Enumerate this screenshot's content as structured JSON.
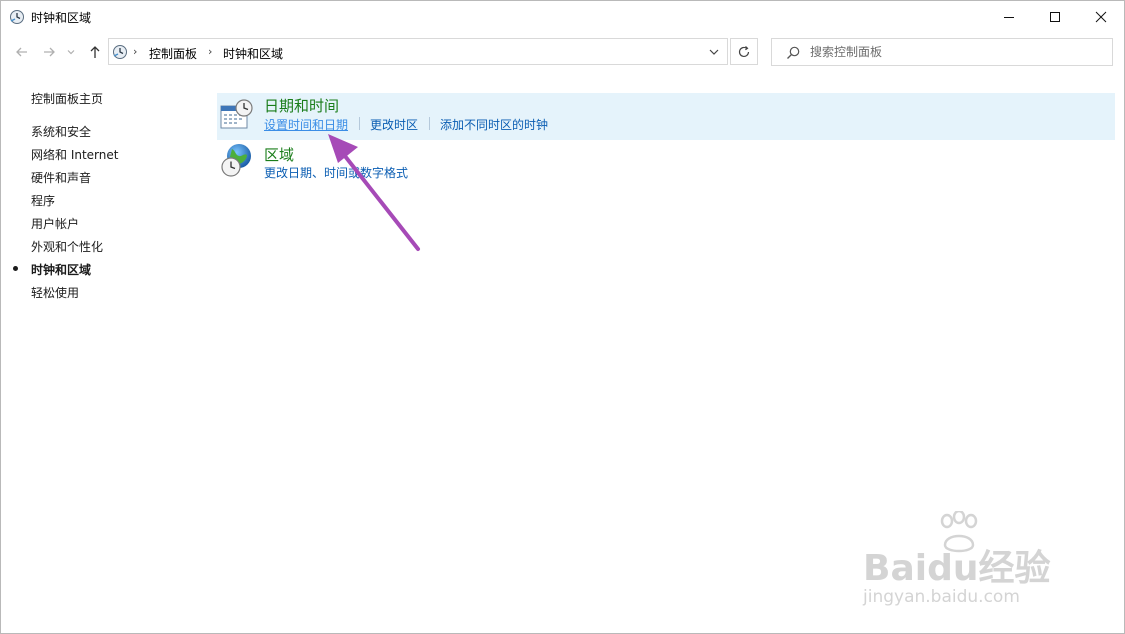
{
  "window": {
    "title": "时钟和区域",
    "controls": {
      "minimize": "minimize",
      "maximize": "maximize",
      "close": "close"
    }
  },
  "address": {
    "breadcrumb": [
      "控制面板",
      "时钟和区域"
    ]
  },
  "search": {
    "placeholder": "搜索控制面板"
  },
  "sidebar": {
    "home": "控制面板主页",
    "items": [
      {
        "label": "系统和安全",
        "active": false
      },
      {
        "label": "网络和 Internet",
        "active": false
      },
      {
        "label": "硬件和声音",
        "active": false
      },
      {
        "label": "程序",
        "active": false
      },
      {
        "label": "用户帐户",
        "active": false
      },
      {
        "label": "外观和个性化",
        "active": false
      },
      {
        "label": "时钟和区域",
        "active": true
      },
      {
        "label": "轻松使用",
        "active": false
      }
    ]
  },
  "categories": [
    {
      "title": "日期和时间",
      "icon": "calendar-clock-icon",
      "links": [
        "设置时间和日期",
        "更改时区",
        "添加不同时区的时钟"
      ]
    },
    {
      "title": "区域",
      "icon": "globe-clock-icon",
      "links": [
        "更改日期、时间或数字格式"
      ]
    }
  ],
  "watermark": {
    "brand": "Baidu经验",
    "url": "jingyan.baidu.com"
  },
  "colors": {
    "highlight": "#e5f3fb",
    "category_title": "#1a7d1a",
    "link": "#0b5eb3",
    "annotation_arrow": "#a64ab7"
  }
}
